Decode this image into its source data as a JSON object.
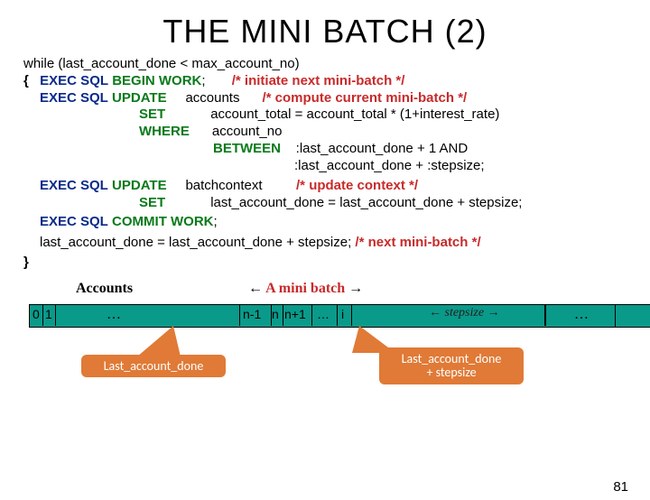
{
  "title": "THE MINI BATCH (2)",
  "code": {
    "l1_while": "while (last_account_done < max_account_no)",
    "l2_brace": "{",
    "l2_exec": "EXEC SQL",
    "l2_begin": "BEGIN WORK",
    "l2_semi": ";",
    "l2_note": "/* initiate next mini-batch */",
    "l3_exec": "EXEC SQL",
    "l3_update": "UPDATE",
    "l3_tbl": "accounts",
    "l3_note": "/* compute current mini-batch */",
    "l4_set": "SET",
    "l4_expr": "account_total = account_total * (1+interest_rate)",
    "l5_where": "WHERE",
    "l5_col": "account_no",
    "l6_between": "BETWEEN",
    "l6_cond1": ":last_account_done + 1 AND",
    "l7_cond2": ":last_account_done + :stepsize;",
    "l8_exec": "EXEC SQL",
    "l8_update": "UPDATE",
    "l8_tbl": "batchcontext",
    "l8_note": "/* update context */",
    "l9_set": "SET",
    "l9_expr": "last_account_done = last_account_done + stepsize;",
    "l10_exec": "EXEC SQL",
    "l10_commit": "COMMIT WORK",
    "l10_semi": ";",
    "l11_stmt": "last_account_done = last_account_done + stepsize;",
    "l11_note": "/* next mini-batch */",
    "l12_brace": "}"
  },
  "diagram": {
    "accounts_label": "Accounts",
    "minibatch_label": "A mini batch",
    "cell0": "0",
    "cell1": "1",
    "cell_nminus1": "n-1",
    "cell_n": "n",
    "cell_nplus1": "n+1",
    "cell_dots": "…",
    "cell_i": "i",
    "ellipsis": "…",
    "stepsize_label": "stepsize",
    "callout1": "Last_account_done",
    "callout2_l1": "Last_account_done",
    "callout2_l2": "+ stepsize"
  },
  "page_number": "81"
}
